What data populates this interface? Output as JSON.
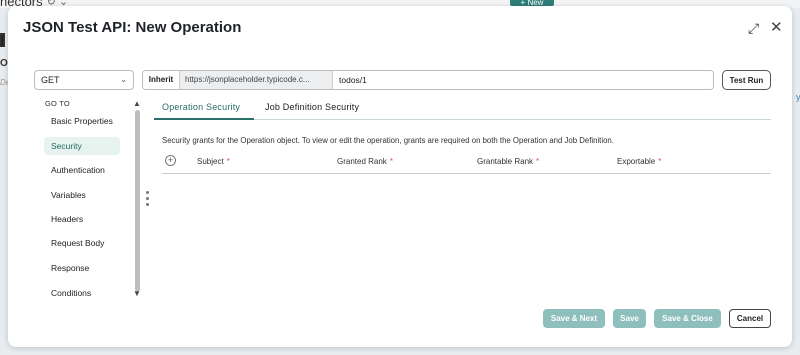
{
  "background": {
    "tab_label": "nectors",
    "new_button": "+ New",
    "left_text_1": "I",
    "left_text_2": "OI",
    "left_text_3": "Des",
    "right_text": "y"
  },
  "modal": {
    "title": "JSON Test API: New Operation"
  },
  "request": {
    "method": "GET",
    "inherit_label": "Inherit",
    "base_url": "https://jsonplaceholder.typicode.c...",
    "path": "todos/1",
    "test_run_label": "Test Run"
  },
  "sidebar": {
    "heading": "GO TO",
    "items": [
      {
        "label": "Basic Properties"
      },
      {
        "label": "Security"
      },
      {
        "label": "Authentication"
      },
      {
        "label": "Variables"
      },
      {
        "label": "Headers"
      },
      {
        "label": "Request Body"
      },
      {
        "label": "Response"
      },
      {
        "label": "Conditions"
      }
    ],
    "active_index": 1
  },
  "tabs": [
    {
      "label": "Operation Security"
    },
    {
      "label": "Job Definition Security"
    }
  ],
  "security": {
    "description": "Security grants for the Operation object. To view or edit the operation, grants are required on both the Operation and Job Definition.",
    "columns": [
      {
        "label": "Subject",
        "required": "*"
      },
      {
        "label": "Granted Rank",
        "required": "*"
      },
      {
        "label": "Grantable Rank",
        "required": "*"
      },
      {
        "label": "Exportable",
        "required": "*"
      }
    ]
  },
  "footer": {
    "save_next": "Save & Next",
    "save": "Save",
    "save_close": "Save & Close",
    "cancel": "Cancel"
  },
  "colors": {
    "accent": "#2a6f6a",
    "disabled_button": "#8fbfbd",
    "active_nav_bg": "#e6f3ef",
    "required": "#d9534f"
  }
}
